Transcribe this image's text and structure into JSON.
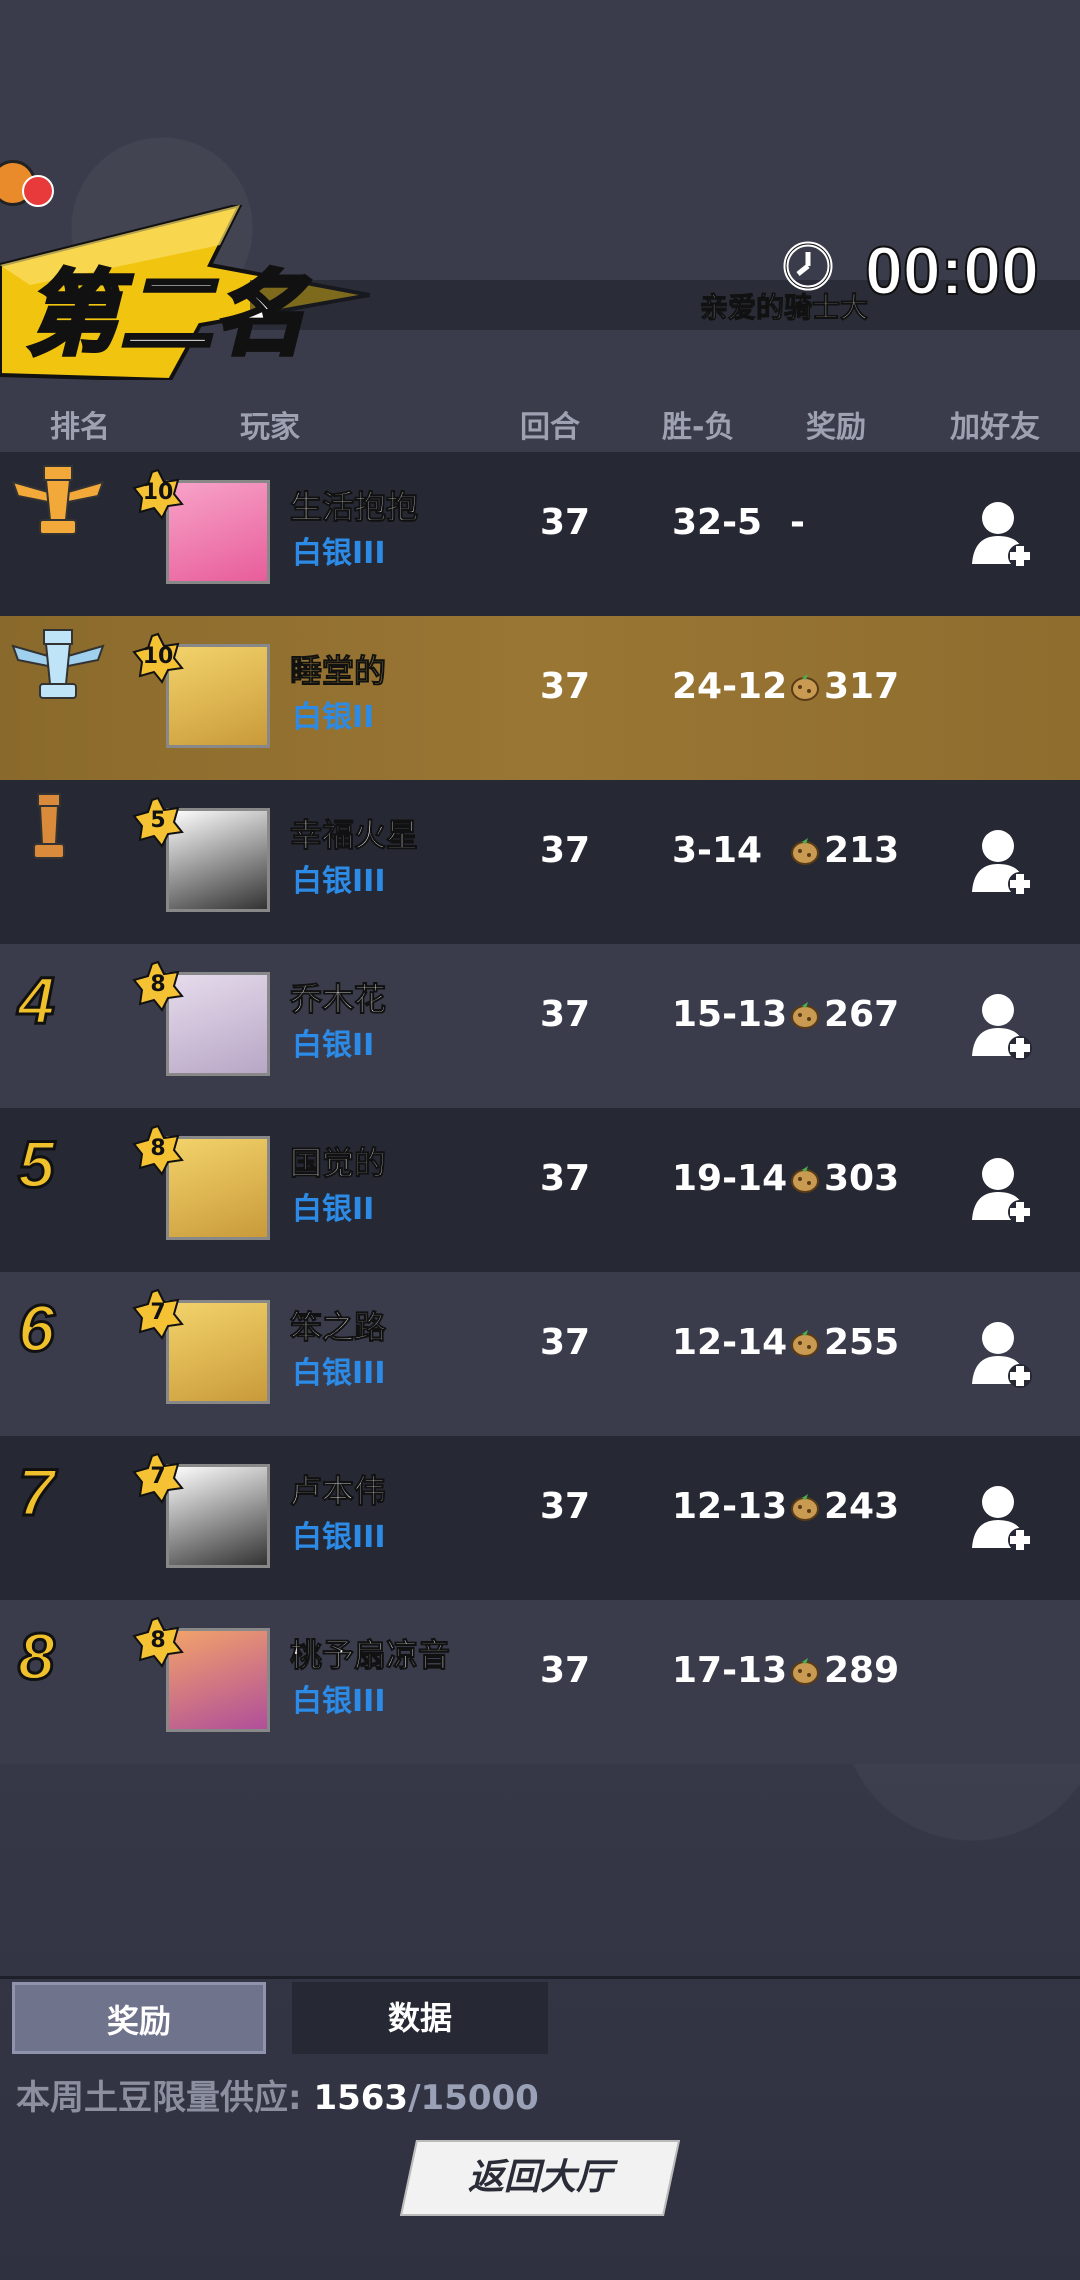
{
  "header": {
    "placement_title": "第二名",
    "timer": "00:00",
    "subtitle": "亲爱的骑士大"
  },
  "columns": {
    "rank": "排名",
    "player": "玩家",
    "rounds": "回合",
    "win_loss": "胜-负",
    "reward": "奖励",
    "add_friend": "加好友"
  },
  "players": [
    {
      "rank": "1",
      "level": "10",
      "name": "生活抱抱",
      "tier": "白银III",
      "rounds": "37",
      "wl": "32-5",
      "reward": "-",
      "friend": true
    },
    {
      "rank": "2",
      "level": "10",
      "name": "睡堂的",
      "tier": "白银II",
      "rounds": "37",
      "wl": "24-12",
      "reward": "317",
      "friend": false
    },
    {
      "rank": "3",
      "level": "5",
      "name": "幸福火星",
      "tier": "白银III",
      "rounds": "37",
      "wl": "3-14",
      "reward": "213",
      "friend": true
    },
    {
      "rank": "4",
      "level": "8",
      "name": "乔木花",
      "tier": "白银II",
      "rounds": "37",
      "wl": "15-13",
      "reward": "267",
      "friend": true
    },
    {
      "rank": "5",
      "level": "8",
      "name": "国觉的",
      "tier": "白银II",
      "rounds": "37",
      "wl": "19-14",
      "reward": "303",
      "friend": true
    },
    {
      "rank": "6",
      "level": "7",
      "name": "笨之路",
      "tier": "白银III",
      "rounds": "37",
      "wl": "12-14",
      "reward": "255",
      "friend": true
    },
    {
      "rank": "7",
      "level": "7",
      "name": "卢本伟",
      "tier": "白银III",
      "rounds": "37",
      "wl": "12-13",
      "reward": "243",
      "friend": true
    },
    {
      "rank": "8",
      "level": "8",
      "name": "桃予扇凉音",
      "tier": "白银III",
      "rounds": "37",
      "wl": "17-13",
      "reward": "289",
      "friend": false
    }
  ],
  "tabs": {
    "reward": "奖励",
    "stats": "数据"
  },
  "supply": {
    "label": "本周土豆限量供应:",
    "current": "1563",
    "max": "/15000"
  },
  "back_button": "返回大厅",
  "colors": {
    "highlight_row": "#9a7634",
    "rank_number": "#f0c12a",
    "tier_blue": "#2b8be6",
    "self_name": "#f5c842"
  }
}
